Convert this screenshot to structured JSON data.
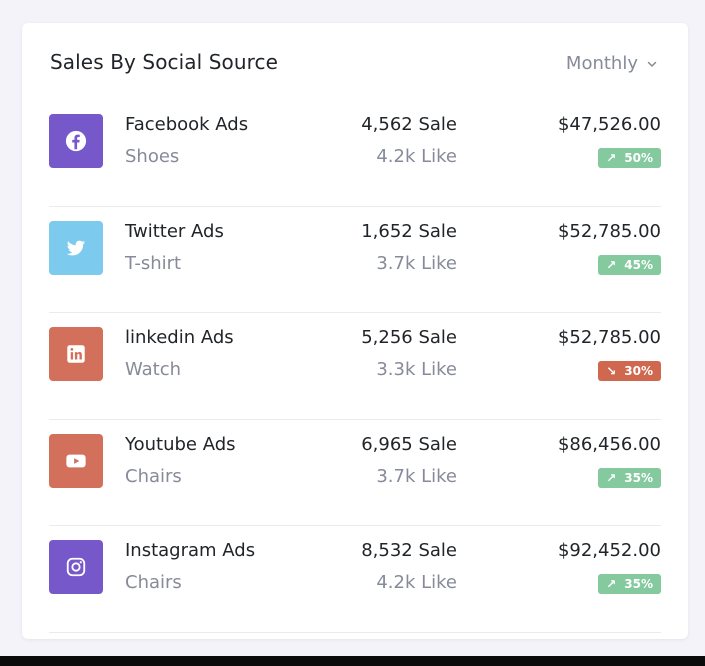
{
  "card": {
    "title": "Sales By Social Source",
    "period_label": "Monthly"
  },
  "rows": [
    {
      "icon": "facebook-icon",
      "icon_bg": "#7758ca",
      "name": "Facebook Ads",
      "category": "Shoes",
      "sales": "4,562 Sale",
      "likes": "4.2k Like",
      "amount": "$47,526.00",
      "badge": {
        "text": "50%",
        "arrow": "↗",
        "trend": "up",
        "color": "#85c99f"
      }
    },
    {
      "icon": "twitter-icon",
      "icon_bg": "#7ccaee",
      "name": "Twitter Ads",
      "category": "T-shirt",
      "sales": "1,652 Sale",
      "likes": "3.7k Like",
      "amount": "$52,785.00",
      "badge": {
        "text": "45%",
        "arrow": "↗",
        "trend": "up",
        "color": "#85c99f"
      }
    },
    {
      "icon": "linkedin-icon",
      "icon_bg": "#d3705c",
      "name": "linkedin Ads",
      "category": "Watch",
      "sales": "5,256 Sale",
      "likes": "3.3k Like",
      "amount": "$52,785.00",
      "badge": {
        "text": "30%",
        "arrow": "↘",
        "trend": "down",
        "color": "#d0674f"
      }
    },
    {
      "icon": "youtube-icon",
      "icon_bg": "#d3705c",
      "name": "Youtube Ads",
      "category": "Chairs",
      "sales": "6,965 Sale",
      "likes": "3.7k Like",
      "amount": "$86,456.00",
      "badge": {
        "text": "35%",
        "arrow": "↗",
        "trend": "up",
        "color": "#85c99f"
      }
    },
    {
      "icon": "instagram-icon",
      "icon_bg": "#7758ca",
      "name": "Instagram Ads",
      "category": "Chairs",
      "sales": "8,532 Sale",
      "likes": "4.2k Like",
      "amount": "$92,452.00",
      "badge": {
        "text": "35%",
        "arrow": "↗",
        "trend": "up",
        "color": "#85c99f"
      }
    }
  ]
}
